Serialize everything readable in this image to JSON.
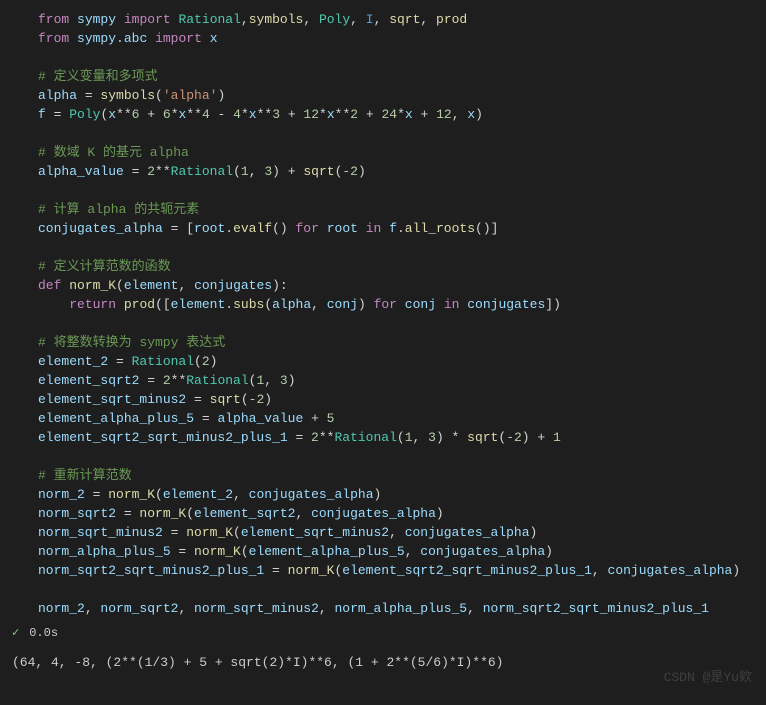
{
  "code": {
    "l1": {
      "kw_from": "from",
      "mod1": "sympy",
      "kw_import": "import",
      "t_rational": "Rational",
      "sym": "symbols",
      "poly": "Poly",
      "I": "I",
      "sqrt": "sqrt",
      "prod": "prod"
    },
    "l2": {
      "kw_from": "from",
      "mod": "sympy.abc",
      "kw_import": "import",
      "x": "x"
    },
    "c1": "# 定义变量和多项式",
    "l4": {
      "alpha": "alpha",
      "eq": " = ",
      "sym": "symbols",
      "str": "'alpha'"
    },
    "l5": {
      "f": "f",
      "eq": " = ",
      "poly": "Poly",
      "expr_a": "x",
      "p6": "6",
      "plus1": " + ",
      "n6": "6",
      "mul1": "*",
      "x2": "x",
      "p4": "4",
      "minus": " - ",
      "n4": "4",
      "x3": "x",
      "p3": "3",
      "plus2": " + ",
      "n12": "12",
      "x4": "x",
      "p2": "2",
      "plus3": " + ",
      "n24": "24",
      "x5": "x",
      "plus4": " + ",
      "n12b": "12",
      "comma": ", ",
      "xf": "x"
    },
    "c2": "# 数域 K 的基元 alpha",
    "l7": {
      "av": "alpha_value",
      "eq": " = ",
      "n2": "2",
      "rat": "Rational",
      "n1": "1",
      "n3": "3",
      "plus": " + ",
      "sqrt": "sqrt",
      "neg2": "-2"
    },
    "c3": "# 计算 alpha 的共轭元素",
    "l9": {
      "ca": "conjugates_alpha",
      "eq": " = ",
      "root": "root",
      "evalf": "evalf",
      "kw_for": "for",
      "kw_in": "in",
      "f": "f",
      "allroots": "all_roots"
    },
    "c4": "# 定义计算范数的函数",
    "l11": {
      "def": "def",
      "fn": "norm_K",
      "elem": "element",
      "conj": "conjugates"
    },
    "l12": {
      "ret": "return",
      "prod": "prod",
      "elem": "element",
      "subs": "subs",
      "alpha": "alpha",
      "conj": "conj",
      "kw_for": "for",
      "kw_in": "in",
      "conjs": "conjugates"
    },
    "c5": "# 将整数转换为 sympy 表达式",
    "l14": {
      "e2": "element_2",
      "rat": "Rational",
      "n2": "2"
    },
    "l15": {
      "es2": "element_sqrt2",
      "n2": "2",
      "rat": "Rational",
      "n1": "1",
      "n3": "3"
    },
    "l16": {
      "esm2": "element_sqrt_minus2",
      "sqrt": "sqrt",
      "neg2": "-2"
    },
    "l17": {
      "eap5": "element_alpha_plus_5",
      "av": "alpha_value",
      "n5": "5"
    },
    "l18": {
      "v": "element_sqrt2_sqrt_minus2_plus_1",
      "n2": "2",
      "rat": "Rational",
      "n1": "1",
      "n3": "3",
      "sqrt": "sqrt",
      "neg2": "-2",
      "n1b": "1"
    },
    "c6": "# 重新计算范数",
    "l20": {
      "n2": "norm_2",
      "nk": "norm_K",
      "e2": "element_2",
      "ca": "conjugates_alpha"
    },
    "l21": {
      "ns2": "norm_sqrt2",
      "nk": "norm_K",
      "es2": "element_sqrt2",
      "ca": "conjugates_alpha"
    },
    "l22": {
      "nsm2": "norm_sqrt_minus2",
      "nk": "norm_K",
      "esm2": "element_sqrt_minus2",
      "ca": "conjugates_alpha"
    },
    "l23": {
      "nap5": "norm_alpha_plus_5",
      "nk": "norm_K",
      "eap5": "element_alpha_plus_5",
      "ca": "conjugates_alpha"
    },
    "l24": {
      "v": "norm_sqrt2_sqrt_minus2_plus_1",
      "nk": "norm_K",
      "ev": "element_sqrt2_sqrt_minus2_plus_1",
      "ca": "conjugates_alpha"
    },
    "l26": {
      "a": "norm_2",
      "b": "norm_sqrt2",
      "c": "norm_sqrt_minus2",
      "d": "norm_alpha_plus_5",
      "e": "norm_sqrt2_sqrt_minus2_plus_1"
    }
  },
  "status": {
    "check": "✓",
    "time": "0.0s"
  },
  "output": "(64, 4, -8, (2**(1/3) + 5 + sqrt(2)*I)**6, (1 + 2**(5/6)*I)**6)",
  "watermark": "CSDN @是Yu欸"
}
